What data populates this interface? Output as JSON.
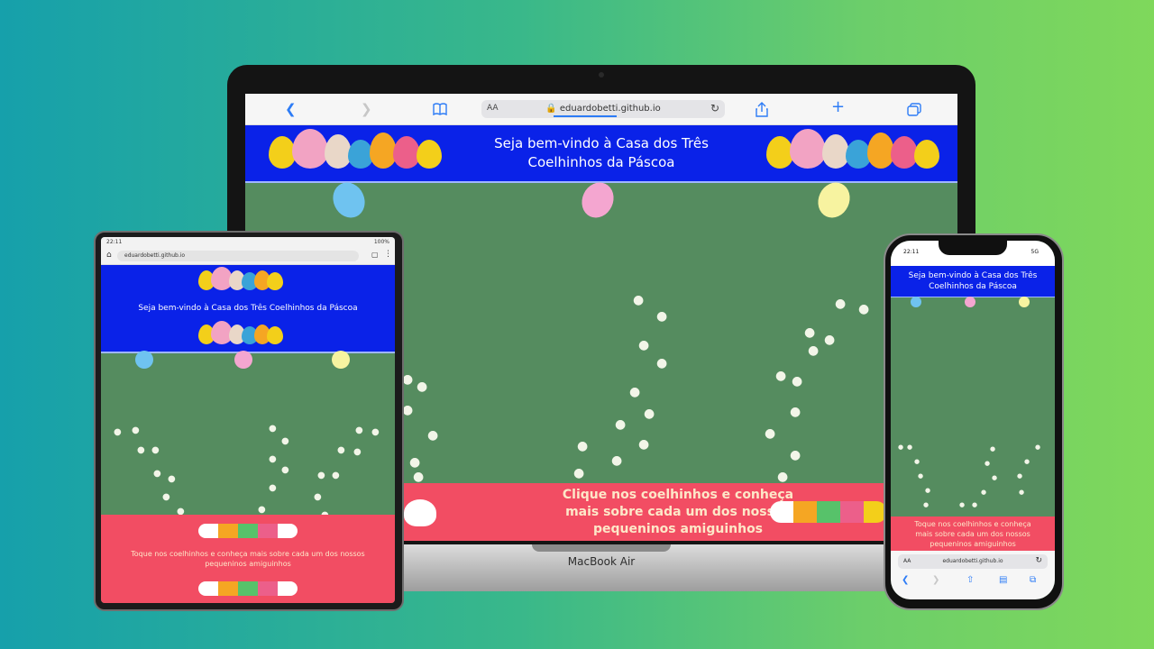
{
  "site": {
    "title": "Seja bem-vindo à Casa dos Três Coelhinhos da Páscoa",
    "title_line1": "Seja bem-vindo à Casa dos Três",
    "title_line2": "Coelhinhos da Páscoa",
    "footer_desktop_line1": "Clique nos coelhinhos e conheça",
    "footer_desktop_line2": "mais sobre cada um dos nossos",
    "footer_desktop_line3": "pequeninos amiguinhos",
    "footer_tablet_line1": "Toque nos coelhinhos e conheça mais sobre cada um dos nossos",
    "footer_tablet_line2": "pequeninos amiguinhos",
    "footer_phone_line1": "Toque nos coelhinhos e conheça",
    "footer_phone_line2": "mais sobre cada um dos nossos",
    "footer_phone_line3": "pequeninos amiguinhos",
    "phone_title_line1": "Seja bem-vindo à Casa dos Três",
    "phone_title_line2": "Coelhinhos da Páscoa"
  },
  "browser": {
    "url": "eduardobetti.github.io",
    "text_size_label": "AA",
    "tablet_time": "22:11",
    "tablet_battery": "100%",
    "phone_time": "22:11",
    "phone_signal": "5G"
  },
  "laptop": {
    "brand": "MacBook Air"
  },
  "colors": {
    "header_blue": "#0a22e8",
    "footer_pink": "#f24d63",
    "field_green": "#558c5f",
    "link_blue": "#2d7cf6"
  },
  "icons": {
    "back": "chevron-left-icon",
    "forward": "chevron-right-icon",
    "bookmarks": "book-icon",
    "reload": "reload-icon",
    "share": "share-icon",
    "new_tab": "plus-icon",
    "tabs": "tabs-icon"
  }
}
